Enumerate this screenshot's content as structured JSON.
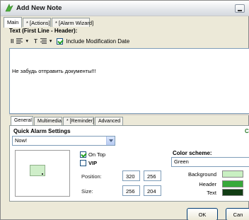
{
  "window": {
    "title": "Add New Note",
    "tabs": [
      "Main",
      "* [Actions]",
      "* [Alarm Wizard]"
    ]
  },
  "editor": {
    "heading": "Text (First Line - Header):",
    "font_size_label": "II",
    "font_style_label": "T",
    "include_date_label": "Include Modification Date",
    "include_date_checked": true,
    "note_text": "Не забудь отправить документы!!!"
  },
  "settings_tabs": [
    "General",
    "Multimedia",
    "* [Reminder]",
    "Advanced"
  ],
  "general": {
    "quick_alarm_heading": "Quick Alarm Settings",
    "quick_alarm_value": "Now!",
    "right_edge_letter": "C",
    "on_top_label": "On Top",
    "on_top_checked": true,
    "vip_label": "VIP",
    "vip_checked": false,
    "position_label": "Position:",
    "position_x": "320",
    "position_y": "256",
    "size_label": "Size:",
    "size_w": "256",
    "size_h": "204",
    "color_scheme_label": "Color scheme:",
    "color_scheme_value": "Green",
    "colors": {
      "background_label": "Background",
      "background": "#c9f0c2",
      "header_label": "Header",
      "header": "#37a93a",
      "text_label": "Text",
      "text": "#123d14"
    }
  },
  "buttons": {
    "ok": "OK",
    "cancel": "Can"
  }
}
